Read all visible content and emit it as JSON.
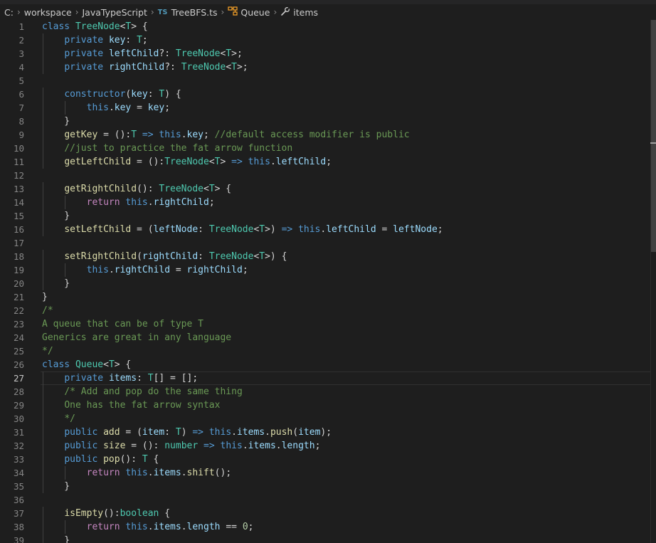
{
  "breadcrumb": {
    "drive": "C:",
    "folder1": "workspace",
    "folder2": "JavaTypeScript",
    "file_badge": "TS",
    "file": "TreeBFS.ts",
    "class": "Queue",
    "member": "items"
  },
  "editor": {
    "language": "typescript",
    "active_line": 27,
    "lines": [
      [
        [
          "class",
          "kw"
        ],
        [
          " ",
          ""
        ],
        [
          "TreeNode",
          "type"
        ],
        [
          "<",
          ""
        ],
        [
          "T",
          "type"
        ],
        [
          "> {",
          ""
        ]
      ],
      [
        [
          "    ",
          ""
        ],
        [
          "private",
          "kw"
        ],
        [
          " ",
          ""
        ],
        [
          "key",
          "var"
        ],
        [
          ": ",
          ""
        ],
        [
          "T",
          "type"
        ],
        [
          ";",
          ""
        ]
      ],
      [
        [
          "    ",
          ""
        ],
        [
          "private",
          "kw"
        ],
        [
          " ",
          ""
        ],
        [
          "leftChild",
          "var"
        ],
        [
          "?: ",
          ""
        ],
        [
          "TreeNode",
          "type"
        ],
        [
          "<",
          ""
        ],
        [
          "T",
          "type"
        ],
        [
          ">;",
          ""
        ]
      ],
      [
        [
          "    ",
          ""
        ],
        [
          "private",
          "kw"
        ],
        [
          " ",
          ""
        ],
        [
          "rightChild",
          "var"
        ],
        [
          "?: ",
          ""
        ],
        [
          "TreeNode",
          "type"
        ],
        [
          "<",
          ""
        ],
        [
          "T",
          "type"
        ],
        [
          ">;",
          ""
        ]
      ],
      [],
      [
        [
          "    ",
          ""
        ],
        [
          "constructor",
          "kw"
        ],
        [
          "(",
          ""
        ],
        [
          "key",
          "var"
        ],
        [
          ": ",
          ""
        ],
        [
          "T",
          "type"
        ],
        [
          ") {",
          ""
        ]
      ],
      [
        [
          "        ",
          ""
        ],
        [
          "this",
          "kw"
        ],
        [
          ".",
          ""
        ],
        [
          "key",
          "var"
        ],
        [
          " = ",
          ""
        ],
        [
          "key",
          "var"
        ],
        [
          ";",
          ""
        ]
      ],
      [
        [
          "    }",
          ""
        ]
      ],
      [
        [
          "    ",
          ""
        ],
        [
          "getKey",
          "fn"
        ],
        [
          " = ():",
          ""
        ],
        [
          "T",
          "type"
        ],
        [
          " ",
          ""
        ],
        [
          "=>",
          "kw"
        ],
        [
          " ",
          ""
        ],
        [
          "this",
          "kw"
        ],
        [
          ".",
          ""
        ],
        [
          "key",
          "var"
        ],
        [
          "; ",
          ""
        ],
        [
          "//default access modifier is public",
          "cm"
        ]
      ],
      [
        [
          "    ",
          ""
        ],
        [
          "//just to practice the fat arrow function",
          "cm"
        ]
      ],
      [
        [
          "    ",
          ""
        ],
        [
          "getLeftChild",
          "fn"
        ],
        [
          " = ():",
          ""
        ],
        [
          "TreeNode",
          "type"
        ],
        [
          "<",
          ""
        ],
        [
          "T",
          "type"
        ],
        [
          "> ",
          ""
        ],
        [
          "=>",
          "kw"
        ],
        [
          " ",
          ""
        ],
        [
          "this",
          "kw"
        ],
        [
          ".",
          ""
        ],
        [
          "leftChild",
          "var"
        ],
        [
          ";",
          ""
        ]
      ],
      [],
      [
        [
          "    ",
          ""
        ],
        [
          "getRightChild",
          "fn"
        ],
        [
          "(): ",
          ""
        ],
        [
          "TreeNode",
          "type"
        ],
        [
          "<",
          ""
        ],
        [
          "T",
          "type"
        ],
        [
          "> {",
          ""
        ]
      ],
      [
        [
          "        ",
          ""
        ],
        [
          "return",
          "ctrl"
        ],
        [
          " ",
          ""
        ],
        [
          "this",
          "kw"
        ],
        [
          ".",
          ""
        ],
        [
          "rightChild",
          "var"
        ],
        [
          ";",
          ""
        ]
      ],
      [
        [
          "    }",
          ""
        ]
      ],
      [
        [
          "    ",
          ""
        ],
        [
          "setLeftChild",
          "fn"
        ],
        [
          " = (",
          ""
        ],
        [
          "leftNode",
          "var"
        ],
        [
          ": ",
          ""
        ],
        [
          "TreeNode",
          "type"
        ],
        [
          "<",
          ""
        ],
        [
          "T",
          "type"
        ],
        [
          ">) ",
          ""
        ],
        [
          "=>",
          "kw"
        ],
        [
          " ",
          ""
        ],
        [
          "this",
          "kw"
        ],
        [
          ".",
          ""
        ],
        [
          "leftChild",
          "var"
        ],
        [
          " = ",
          ""
        ],
        [
          "leftNode",
          "var"
        ],
        [
          ";",
          ""
        ]
      ],
      [],
      [
        [
          "    ",
          ""
        ],
        [
          "setRightChild",
          "fn"
        ],
        [
          "(",
          ""
        ],
        [
          "rightChild",
          "var"
        ],
        [
          ": ",
          ""
        ],
        [
          "TreeNode",
          "type"
        ],
        [
          "<",
          ""
        ],
        [
          "T",
          "type"
        ],
        [
          ">) {",
          ""
        ]
      ],
      [
        [
          "        ",
          ""
        ],
        [
          "this",
          "kw"
        ],
        [
          ".",
          ""
        ],
        [
          "rightChild",
          "var"
        ],
        [
          " = ",
          ""
        ],
        [
          "rightChild",
          "var"
        ],
        [
          ";",
          ""
        ]
      ],
      [
        [
          "    }",
          ""
        ]
      ],
      [
        [
          "}",
          ""
        ]
      ],
      [
        [
          "/*",
          "cm"
        ]
      ],
      [
        [
          "A queue that can be of type T",
          "cm"
        ]
      ],
      [
        [
          "Generics are great in any language",
          "cm"
        ]
      ],
      [
        [
          "*/",
          "cm"
        ]
      ],
      [
        [
          "class",
          "kw"
        ],
        [
          " ",
          ""
        ],
        [
          "Queue",
          "type"
        ],
        [
          "<",
          ""
        ],
        [
          "T",
          "type"
        ],
        [
          "> {",
          ""
        ]
      ],
      [
        [
          "    ",
          ""
        ],
        [
          "private",
          "kw"
        ],
        [
          " ",
          ""
        ],
        [
          "items",
          "var"
        ],
        [
          ": ",
          ""
        ],
        [
          "T",
          "type"
        ],
        [
          "[] = [];",
          ""
        ]
      ],
      [
        [
          "    ",
          ""
        ],
        [
          "/* Add and pop do the same thing",
          "cm"
        ]
      ],
      [
        [
          "    ",
          ""
        ],
        [
          "One has the fat arrow syntax",
          "cm"
        ]
      ],
      [
        [
          "    ",
          ""
        ],
        [
          "*/",
          "cm"
        ]
      ],
      [
        [
          "    ",
          ""
        ],
        [
          "public",
          "kw"
        ],
        [
          " ",
          ""
        ],
        [
          "add",
          "fn"
        ],
        [
          " = (",
          ""
        ],
        [
          "item",
          "var"
        ],
        [
          ": ",
          ""
        ],
        [
          "T",
          "type"
        ],
        [
          ") ",
          ""
        ],
        [
          "=>",
          "kw"
        ],
        [
          " ",
          ""
        ],
        [
          "this",
          "kw"
        ],
        [
          ".",
          ""
        ],
        [
          "items",
          "var"
        ],
        [
          ".",
          ""
        ],
        [
          "push",
          "fn"
        ],
        [
          "(",
          ""
        ],
        [
          "item",
          "var"
        ],
        [
          ");",
          ""
        ]
      ],
      [
        [
          "    ",
          ""
        ],
        [
          "public",
          "kw"
        ],
        [
          " ",
          ""
        ],
        [
          "size",
          "fn"
        ],
        [
          " = (): ",
          ""
        ],
        [
          "number",
          "type"
        ],
        [
          " ",
          ""
        ],
        [
          "=>",
          "kw"
        ],
        [
          " ",
          ""
        ],
        [
          "this",
          "kw"
        ],
        [
          ".",
          ""
        ],
        [
          "items",
          "var"
        ],
        [
          ".",
          ""
        ],
        [
          "length",
          "var"
        ],
        [
          ";",
          ""
        ]
      ],
      [
        [
          "    ",
          ""
        ],
        [
          "public",
          "kw"
        ],
        [
          " ",
          ""
        ],
        [
          "pop",
          "fn"
        ],
        [
          "(): ",
          ""
        ],
        [
          "T",
          "type"
        ],
        [
          " {",
          ""
        ]
      ],
      [
        [
          "        ",
          ""
        ],
        [
          "return",
          "ctrl"
        ],
        [
          " ",
          ""
        ],
        [
          "this",
          "kw"
        ],
        [
          ".",
          ""
        ],
        [
          "items",
          "var"
        ],
        [
          ".",
          ""
        ],
        [
          "shift",
          "fn"
        ],
        [
          "();",
          ""
        ]
      ],
      [
        [
          "    }",
          ""
        ]
      ],
      [],
      [
        [
          "    ",
          ""
        ],
        [
          "isEmpty",
          "fn"
        ],
        [
          "():",
          ""
        ],
        [
          "boolean",
          "type"
        ],
        [
          " {",
          ""
        ]
      ],
      [
        [
          "        ",
          ""
        ],
        [
          "return",
          "ctrl"
        ],
        [
          " ",
          ""
        ],
        [
          "this",
          "kw"
        ],
        [
          ".",
          ""
        ],
        [
          "items",
          "var"
        ],
        [
          ".",
          ""
        ],
        [
          "length",
          "var"
        ],
        [
          " == ",
          ""
        ],
        [
          "0",
          "num"
        ],
        [
          ";",
          ""
        ]
      ],
      [
        [
          "    }",
          ""
        ]
      ]
    ]
  }
}
